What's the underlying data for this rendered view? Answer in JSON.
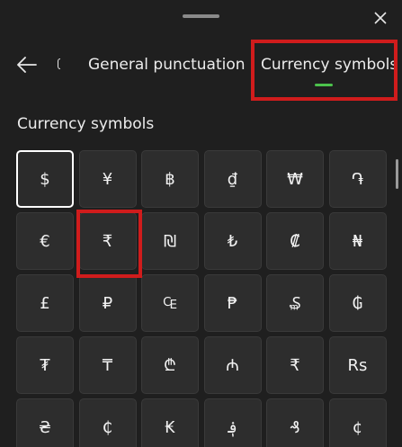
{
  "header": {
    "drag_handle_icon": "drag-handle-icon",
    "close_icon": "close-icon",
    "back_icon": "back-arrow-icon"
  },
  "tabs": [
    {
      "label": "General punctuation",
      "selected": false
    },
    {
      "label": "Currency symbols",
      "selected": true
    }
  ],
  "indicator_color": "#4cc24c",
  "highlight_color": "#d01c1c",
  "section": {
    "title": "Currency symbols"
  },
  "symbols": [
    [
      "$",
      "¥",
      "฿",
      "₫",
      "₩",
      "֏"
    ],
    [
      "€",
      "₹",
      "₪",
      "₺",
      "₡",
      "₦"
    ],
    [
      "£",
      "₽",
      "₠",
      "₱",
      "₷",
      "₲"
    ],
    [
      "₮",
      "₸",
      "₾",
      "₼",
      "₹",
      "Rs"
    ],
    [
      "₴",
      "₵",
      "₭",
      "؋",
      "₰",
      "¢"
    ]
  ],
  "selected_symbol": "$"
}
